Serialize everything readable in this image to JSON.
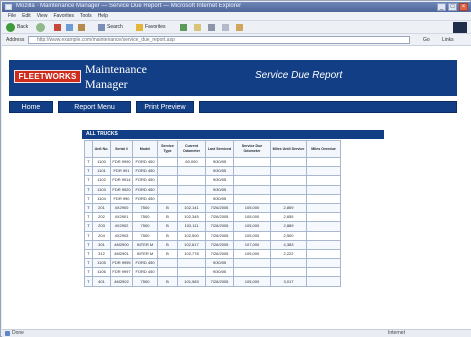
{
  "browser": {
    "window_title": "Mozilla · Maintenance Manager — Service Due Report — Microsoft Internet Explorer",
    "menu": [
      "File",
      "Edit",
      "View",
      "Favorites",
      "Tools",
      "Help"
    ],
    "toolbar": {
      "back": "Back",
      "search": "Search",
      "favorites": "Favorites"
    },
    "address_label": "Address",
    "address_url": "http://www.example.com/maintenance/service_due_report.asp",
    "go_label": "Go",
    "links_label": "Links",
    "status_text": "Done",
    "status_zone": "Internet",
    "colors": {
      "title_bar": "#4d6598",
      "chrome": "#edf0f5"
    }
  },
  "header": {
    "logo_text": "FLEETWORKS",
    "app_title": "Maintenance Manager",
    "report_title": "Service Due Report",
    "colors": {
      "header_bg": "#123e86",
      "logo_bg": "#cf2c1d"
    }
  },
  "nav": {
    "home": "Home",
    "reports": "Report Menu",
    "print": "Print Preview"
  },
  "table": {
    "title": "ALL TRUCKS",
    "columns": [
      "Unit No.",
      "Serial #",
      "Model",
      "Service Type",
      "Current Odometer",
      "Last Serviced",
      "Service Due Odometer",
      "Miles Until Service",
      "Miles Overdue"
    ],
    "rows": [
      [
        "T",
        "1100",
        "FDR 9990",
        "FORD 450",
        "",
        "60,000",
        "9/30/05",
        "",
        "",
        ""
      ],
      [
        "T",
        "1101",
        "FDR 901",
        "FORD 450",
        "",
        "",
        "9/30/05",
        "",
        "",
        ""
      ],
      [
        "T",
        "1102",
        "FDR 9914",
        "FORD 450",
        "",
        "",
        "9/30/05",
        "",
        "",
        ""
      ],
      [
        "T",
        "1103",
        "FDR 9920",
        "FORD 450",
        "",
        "",
        "9/30/05",
        "",
        "",
        ""
      ],
      [
        "T",
        "1104",
        "FDR 990",
        "FORD 450",
        "",
        "",
        "9/30/05",
        "",
        "",
        ""
      ],
      [
        "T",
        "201",
        "4X2900",
        "7500",
        "B",
        "102,141",
        "7/26/2005",
        "105,000",
        "2,859",
        ""
      ],
      [
        "T",
        "202",
        "4X2901",
        "7500",
        "B",
        "102,345",
        "7/26/2005",
        "105,000",
        "2,655",
        ""
      ],
      [
        "T",
        "203",
        "4X2902",
        "7500",
        "B",
        "102,111",
        "7/26/2005",
        "105,000",
        "2,889",
        ""
      ],
      [
        "T",
        "204",
        "4X2903",
        "7500",
        "B",
        "102,500",
        "7/26/2005",
        "105,000",
        "2,500",
        ""
      ],
      [
        "T",
        "301",
        "4M2900",
        "INTER M",
        "B",
        "102,617",
        "7/26/2005",
        "107,000",
        "4,383",
        ""
      ],
      [
        "T",
        "312",
        "4M2901",
        "INTER M",
        "B",
        "102,778",
        "7/26/2005",
        "105,000",
        "2,222",
        ""
      ],
      [
        "T",
        "1105",
        "FDR 9995",
        "FORD 450",
        "",
        "",
        "9/30/05",
        "",
        "",
        ""
      ],
      [
        "T",
        "1106",
        "FDR 9997",
        "FORD 450",
        "",
        "",
        "9/30/05",
        "",
        "",
        ""
      ],
      [
        "T",
        "401",
        "4M2902",
        "7500",
        "B",
        "101,983",
        "7/26/2005",
        "105,000",
        "3,017",
        ""
      ]
    ]
  }
}
